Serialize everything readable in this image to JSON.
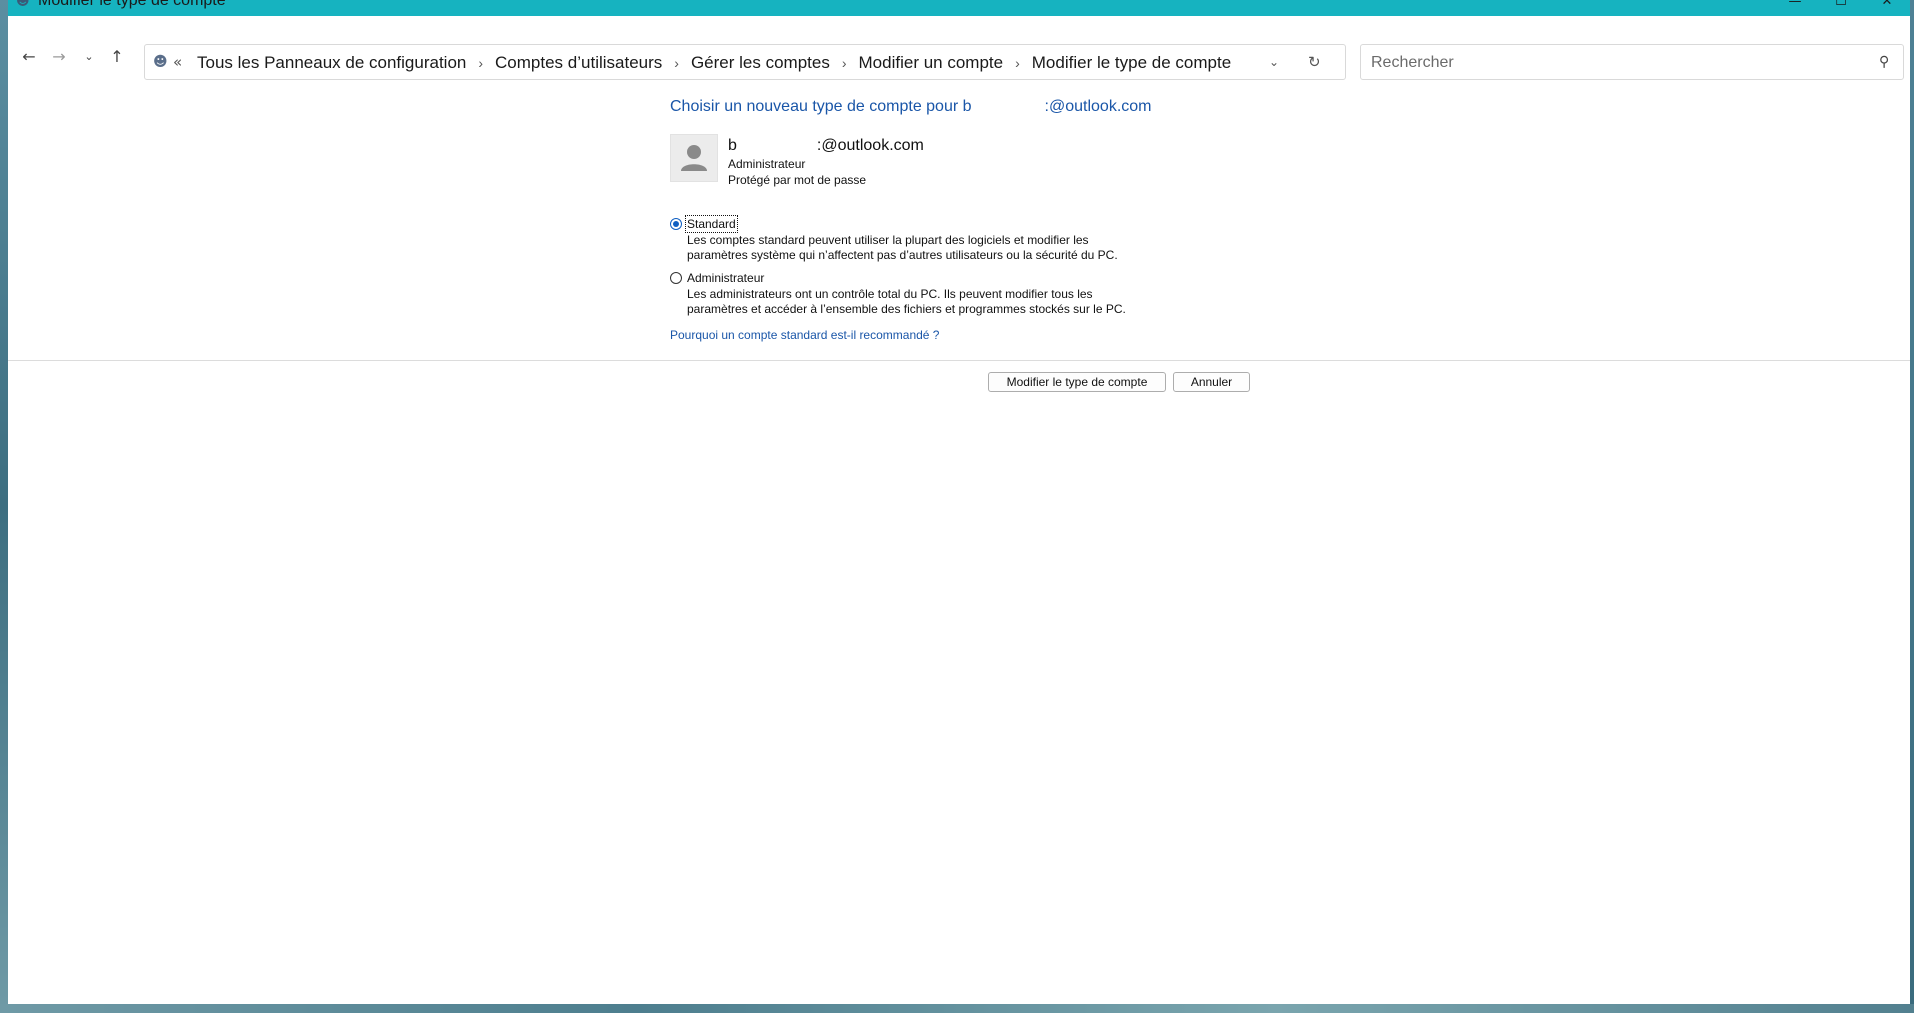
{
  "window": {
    "title": "Modifier le type de compte",
    "app_icon": "users-icon",
    "controls": {
      "minimize": "—",
      "maximize": "☐",
      "close": "✕"
    }
  },
  "nav": {
    "back": "←",
    "forward": "→",
    "recent": "⌄",
    "up": "↑"
  },
  "address": {
    "overflow": "«",
    "breadcrumbs": [
      "Tous les Panneaux de configuration",
      "Comptes d’utilisateurs",
      "Gérer les comptes",
      "Modifier un compte",
      "Modifier le type de compte"
    ],
    "separator": "›",
    "dropdown": "⌄",
    "refresh": "↻"
  },
  "search": {
    "placeholder": "Rechercher",
    "value": ""
  },
  "main": {
    "heading_prefix": "Choisir un nouveau type de compte pour b",
    "heading_suffix": ":@outlook.com",
    "account": {
      "name_prefix": "b",
      "name_suffix": ":@outlook.com",
      "role": "Administrateur",
      "password_status": "Protégé par mot de passe"
    },
    "options": [
      {
        "label": "Standard",
        "checked": true,
        "description": "Les comptes standard peuvent utiliser la plupart des logiciels et modifier les paramètres système qui n’affectent pas d’autres utilisateurs ou la sécurité du PC."
      },
      {
        "label": "Administrateur",
        "checked": false,
        "description": "Les administrateurs ont un contrôle total du PC. Ils peuvent modifier tous les paramètres et accéder à l’ensemble des fichiers et programmes stockés sur le PC."
      }
    ],
    "info_link": "Pourquoi un compte standard est-il recommandé ?"
  },
  "actions": {
    "change_label": "Modifier le type de compte",
    "cancel_label": "Annuler"
  },
  "colors": {
    "titlebar": "#16b3c0",
    "link_blue": "#1a56a8",
    "radio_accent": "#0f5fc2"
  }
}
